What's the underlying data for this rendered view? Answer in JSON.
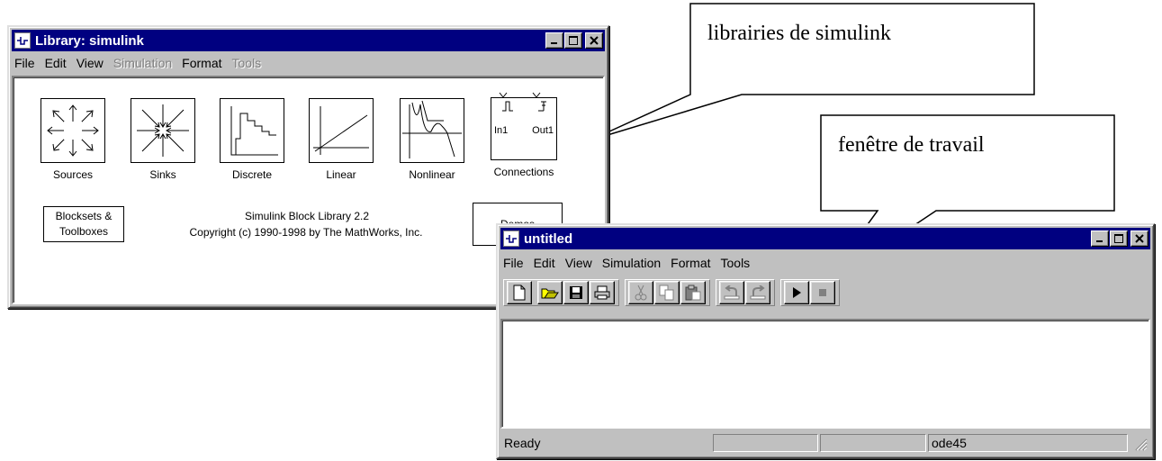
{
  "library_window": {
    "title": "Library: simulink",
    "menu": [
      "File",
      "Edit",
      "View",
      "Simulation",
      "Format",
      "Tools"
    ],
    "disabled_menu": [
      "Simulation",
      "Tools"
    ],
    "blocks": {
      "sources": "Sources",
      "sinks": "Sinks",
      "discrete": "Discrete",
      "linear": "Linear",
      "nonlinear": "Nonlinear",
      "connections": "Connections"
    },
    "connections_ports": {
      "in": "In1",
      "out": "Out1"
    },
    "blocksets_line1": "Blocksets &",
    "blocksets_line2": "Toolboxes",
    "info_line1": "Simulink Block Library 2.2",
    "info_line2": "Copyright (c) 1990-1998 by The MathWorks, Inc.",
    "demos": "Demos"
  },
  "model_window": {
    "title": "untitled",
    "menu": [
      "File",
      "Edit",
      "View",
      "Simulation",
      "Format",
      "Tools"
    ],
    "status": {
      "state": "Ready",
      "cell2": "",
      "cell3": "",
      "solver": "ode45"
    },
    "toolbar_icons": [
      "new-icon",
      "open-icon",
      "save-icon",
      "print-icon",
      "cut-icon",
      "copy-icon",
      "paste-icon",
      "undo-icon",
      "redo-icon",
      "play-icon",
      "stop-icon"
    ]
  },
  "callouts": {
    "library": "librairies de simulink",
    "workspace": "fenêtre de travail"
  },
  "colors": {
    "titlebar": "#000080",
    "window_face": "#c0c0c0",
    "canvas": "#ffffff"
  }
}
